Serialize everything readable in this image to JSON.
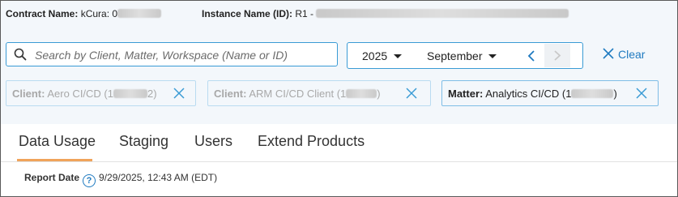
{
  "info": {
    "contract_label": "Contract Name:",
    "contract_value": "kCura: 0",
    "instance_label": "Instance Name (ID):",
    "instance_value": "R1 - "
  },
  "search": {
    "placeholder": "Search by Client, Matter, Workspace (Name or ID)"
  },
  "date_picker": {
    "year": "2025",
    "month": "September"
  },
  "clear_label": "Clear",
  "filters": [
    {
      "label": "Client:",
      "value": "Aero CI/CD (1",
      "value_end": "2)"
    },
    {
      "label": "Client:",
      "value": "ARM CI/CD Client (1",
      "value_end": ")"
    },
    {
      "label": "Matter:",
      "value": "Analytics CI/CD (1",
      "value_end": ")"
    }
  ],
  "tabs": [
    "Data Usage",
    "Staging",
    "Users",
    "Extend Products"
  ],
  "active_tab": "Data Usage",
  "report": {
    "label": "Report Date",
    "value": "9/29/2025, 12:43 AM (EDT)"
  },
  "colors": {
    "accent": "#1f7ac0",
    "border_focus": "#3a9bd5",
    "tab_underline": "#f0a35a"
  },
  "icons": [
    "search-icon",
    "caret-down-icon",
    "chevron-left-icon",
    "chevron-right-icon",
    "close-icon",
    "help-icon"
  ]
}
